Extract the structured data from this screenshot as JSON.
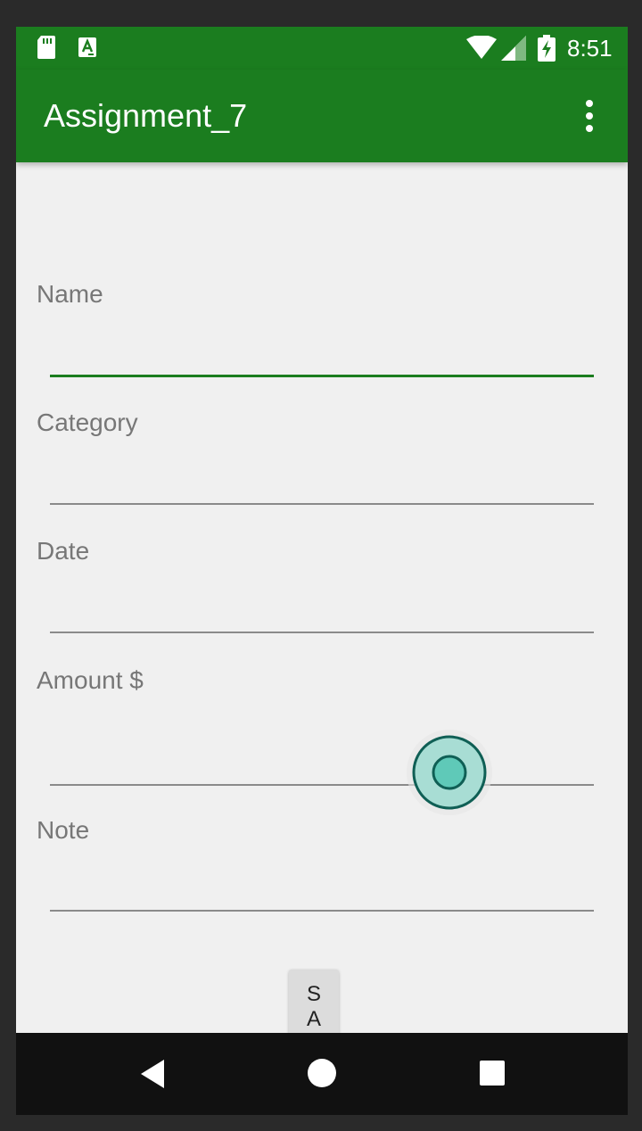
{
  "status_bar": {
    "time": "8:51",
    "icons": [
      "sd-card-icon",
      "text-a-icon",
      "wifi-icon",
      "signal-icon",
      "battery-charging-icon"
    ]
  },
  "app_bar": {
    "title": "Assignment_7",
    "menu_icon": "more-vert-icon"
  },
  "form": {
    "name_label": "Name",
    "name_value": "",
    "category_label": "Category",
    "category_value": "",
    "date_label": "Date",
    "date_value": "",
    "amount_label": "Amount $",
    "amount_value": "",
    "note_label": "Note",
    "note_value": "",
    "save_label": "SA"
  },
  "nav_bar": {
    "icons": [
      "back-icon",
      "home-icon",
      "recents-icon"
    ]
  },
  "colors": {
    "primary": "#1b7d1f",
    "background": "#f0f0f0",
    "label": "#777777",
    "touch_indicator": "#5fc9b8"
  }
}
